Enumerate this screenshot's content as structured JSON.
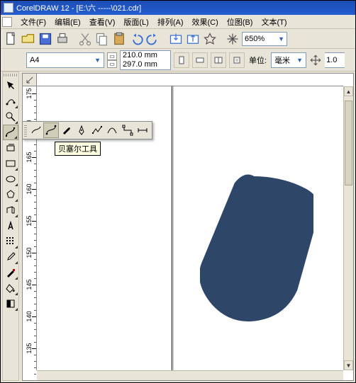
{
  "title": "CorelDRAW 12 - [E:\\六  -----\\021.cdr]",
  "menus": [
    "文件(F)",
    "编辑(E)",
    "查看(V)",
    "版面(L)",
    "排列(A)",
    "效果(C)",
    "位图(B)",
    "文本(T)"
  ],
  "toolbar": {
    "zoom": "650%"
  },
  "propbar": {
    "paper": "A4",
    "width": "210.0 mm",
    "height": "297.0 mm",
    "unit_label": "单位:",
    "unit": "毫米",
    "nudge": "1.0"
  },
  "ruler_marks": [
    "175",
    "170",
    "165",
    "160",
    "155",
    "150",
    "145",
    "140",
    "135"
  ],
  "tooltip": "贝塞尔工具",
  "shape_color": "#2e4668"
}
